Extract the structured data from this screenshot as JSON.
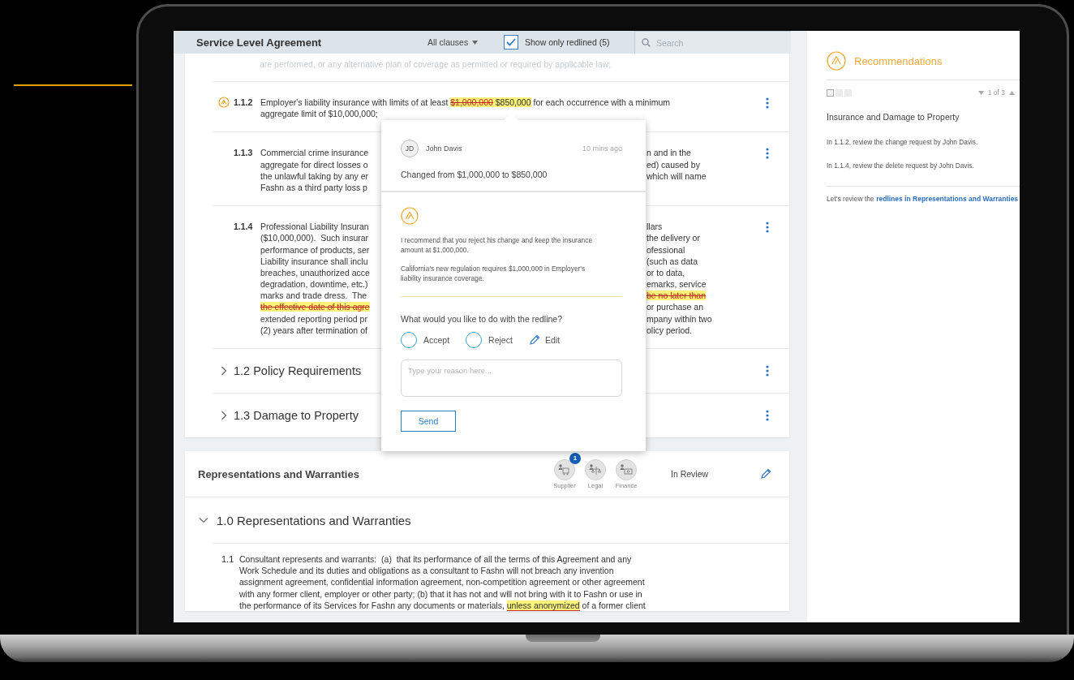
{
  "header": {
    "title": "Service Level Agreement",
    "filter": {
      "label": "All clauses"
    },
    "redlined_filter": {
      "label": "Show only redlined (5)",
      "checked": true
    },
    "search": {
      "placeholder": "Search"
    }
  },
  "agreement": {
    "faded_line": "are performed, or any alternative plan of coverage as permitted or required by applicable law;",
    "clauses": [
      {
        "number": "1.1.2",
        "recommended": true,
        "lines": [
          {
            "left": [
              "Employer's liability insurance with limits of at least ",
              {
                "text": "$1,000,000",
                "kind": "deletion"
              },
              {
                "text": " $850,000",
                "kind": "insertion"
              },
              " for each occurrence with a minimum"
            ]
          },
          {
            "left": [
              "aggregate limit of $10,000,000;"
            ]
          }
        ]
      },
      {
        "number": "1.1.3",
        "recommended": false,
        "lines": [
          {
            "left": [
              "Commercial crime insurance"
            ],
            "right": [
              "n and in the"
            ]
          },
          {
            "left": [
              "aggregate for direct losses o"
            ],
            "right": [
              "ed) caused by"
            ]
          },
          {
            "left": [
              "the unlawful taking by any er"
            ],
            "right": [
              "which will name"
            ]
          },
          {
            "left": [
              "Fashn as a third party loss p"
            ]
          }
        ]
      },
      {
        "number": "1.1.4",
        "recommended": false,
        "lines": [
          {
            "left": [
              "Professional Liability Insuran"
            ],
            "right": [
              "llars"
            ]
          },
          {
            "left": [
              "($10,000,000).  Such insurar"
            ],
            "right": [
              "the delivery or"
            ]
          },
          {
            "left": [
              "performance of products, ser"
            ],
            "right": [
              "ofessional"
            ]
          },
          {
            "left": [
              "Liability insurance shall inclu"
            ],
            "right": [
              "(such as data"
            ]
          },
          {
            "left": [
              "breaches, unauthorized acce"
            ],
            "right": [
              "or to data,"
            ]
          },
          {
            "left": [
              "degradation, downtime, etc.)"
            ],
            "right": [
              "emarks, service"
            ]
          },
          {
            "left": [
              "marks and trade dress.  The"
            ],
            "right": [
              {
                "text": "be no later than",
                "kind": "deletion"
              }
            ]
          },
          {
            "left": [
              {
                "text": "the effective date of this agre",
                "kind": "deletion"
              }
            ],
            "right": [
              "or purchase an"
            ]
          },
          {
            "left": [
              "extended reporting period pr"
            ],
            "right": [
              "mpany within two"
            ]
          },
          {
            "left": [
              "(2) years after termination of"
            ],
            "right": [
              "olicy period."
            ]
          }
        ]
      }
    ],
    "sections": [
      {
        "title": "1.2 Policy Requirements",
        "expanded": false
      },
      {
        "title": "1.3 Damage to Property",
        "expanded": false
      }
    ]
  },
  "popup": {
    "author": {
      "initials": "JD",
      "name": "John Davis"
    },
    "time": "10 mins ago",
    "change": "Changed from $1,000,000 to $850,000",
    "recommendation": [
      "I recommend that you reject his change and keep the insurance amount at $1,000,000.",
      "California's new regulation requires $1,000,000 in Employer's liability insurance coverage."
    ],
    "question": "What would you like to do with the redline?",
    "actions": [
      {
        "kind": "radio",
        "label": "Accept",
        "selected": false
      },
      {
        "kind": "radio",
        "label": "Reject",
        "selected": false
      },
      {
        "kind": "edit",
        "label": "Edit"
      }
    ],
    "reason": {
      "placeholder": "Type your reason here..."
    },
    "send": "Send"
  },
  "review_card": {
    "title": "Representations and Warranties",
    "reviewers": [
      {
        "label": "Supplier",
        "badge": "1"
      },
      {
        "label": "Legal"
      },
      {
        "label": "Finance"
      }
    ],
    "status": "In Review",
    "section": {
      "title": "1.0 Representations and Warranties",
      "expanded": true,
      "clauses": [
        {
          "number": "1.1",
          "lines": [
            {
              "left": [
                "Consultant represents and warrants:  (a)  that its performance of all the terms of this Agreement and any"
              ]
            },
            {
              "left": [
                "Work Schedule and its duties and obligations as a consultant to Fashn will not breach any invention"
              ]
            },
            {
              "left": [
                "assignment agreement, confidential information agreement, non-competition agreement or other agreement"
              ]
            },
            {
              "left": [
                "with any former client, employer or other party; (b) that it has not and will not bring with it to Fashn or use in"
              ]
            },
            {
              "left": [
                "the performance of its Services for Fashn any documents or materials, ",
                {
                  "text": "unless anonymized",
                  "kind": "flag"
                },
                " of a former client"
              ]
            }
          ]
        }
      ]
    }
  },
  "recommendations": {
    "title": "Recommendations",
    "pages": [
      {
        "selected": true
      },
      {
        "selected": false
      },
      {
        "selected": false
      }
    ],
    "counter": "1 of 3",
    "heading": "Insurance and Damage to Property",
    "items": [
      "In 1.1.2, review the change request by John Davis.",
      "In 1.1.4, review the delete request by John Davis."
    ],
    "footer": {
      "text": "Let's review the ",
      "link": "redlines in Representations and Warranties"
    }
  }
}
